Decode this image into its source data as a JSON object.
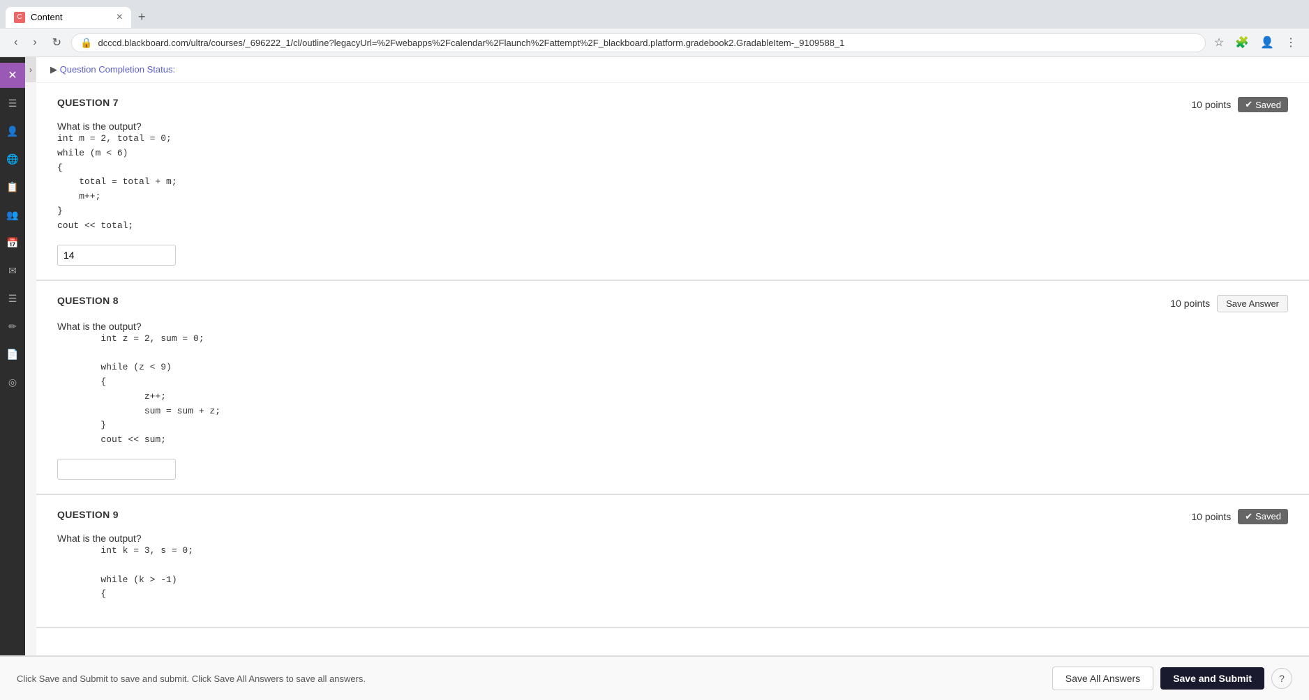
{
  "browser": {
    "tab_title": "Content",
    "url": "dcccd.blackboard.com/ultra/courses/_696222_1/cl/outline?legacyUrl=%2Fwebapps%2Fcalendar%2Flaunch%2Fattempt%2F_blackboard.platform.gradebook2.GradableItem-_9109588_1",
    "new_tab_label": "+"
  },
  "sidebar": {
    "items": [
      {
        "icon": "✕",
        "label": "close-icon"
      },
      {
        "icon": "☰",
        "label": "menu-icon"
      },
      {
        "icon": "👤",
        "label": "profile-icon"
      },
      {
        "icon": "🌐",
        "label": "global-icon"
      },
      {
        "icon": "📋",
        "label": "checklist-icon"
      },
      {
        "icon": "👥",
        "label": "groups-icon"
      },
      {
        "icon": "📅",
        "label": "calendar-icon"
      },
      {
        "icon": "✉",
        "label": "mail-icon"
      },
      {
        "icon": "≡",
        "label": "list-icon"
      },
      {
        "icon": "✏",
        "label": "edit-icon"
      },
      {
        "icon": "📄",
        "label": "document-icon"
      },
      {
        "icon": "◎",
        "label": "circle-icon"
      }
    ]
  },
  "completion_status": {
    "label": "Question Completion Status:"
  },
  "questions": [
    {
      "id": "q7",
      "number": "QUESTION 7",
      "points": "10 points",
      "status": "Saved",
      "status_type": "saved",
      "prompt": "What is the output?",
      "code": "int m = 2, total = 0;\nwhile (m < 6)\n{\n    total = total + m;\n    m++;\n}\ncout << total;",
      "code_preamble": "What is the output?",
      "answer_value": "14",
      "answer_placeholder": ""
    },
    {
      "id": "q8",
      "number": "QUESTION 8",
      "points": "10 points",
      "status": "Save Answer",
      "status_type": "save-answer",
      "prompt": "What is the output?",
      "code": "int z = 2, sum = 0;\n\nwhile (z < 9)\n{\n        z++;\n        sum = sum + z;\n}\ncout << sum;",
      "answer_value": "",
      "answer_placeholder": ""
    },
    {
      "id": "q9",
      "number": "QUESTION 9",
      "points": "10 points",
      "status": "Saved",
      "status_type": "saved",
      "prompt": "What is the output?",
      "code": "int k = 3, s = 0;\n\nwhile (k > -1)\n{",
      "answer_value": "",
      "answer_placeholder": ""
    }
  ],
  "footer": {
    "description": "Click Save and Submit to save and submit. Click Save All Answers to save all answers.",
    "save_all_label": "Save All Answers",
    "save_submit_label": "Save and Submit",
    "help_label": "?"
  }
}
